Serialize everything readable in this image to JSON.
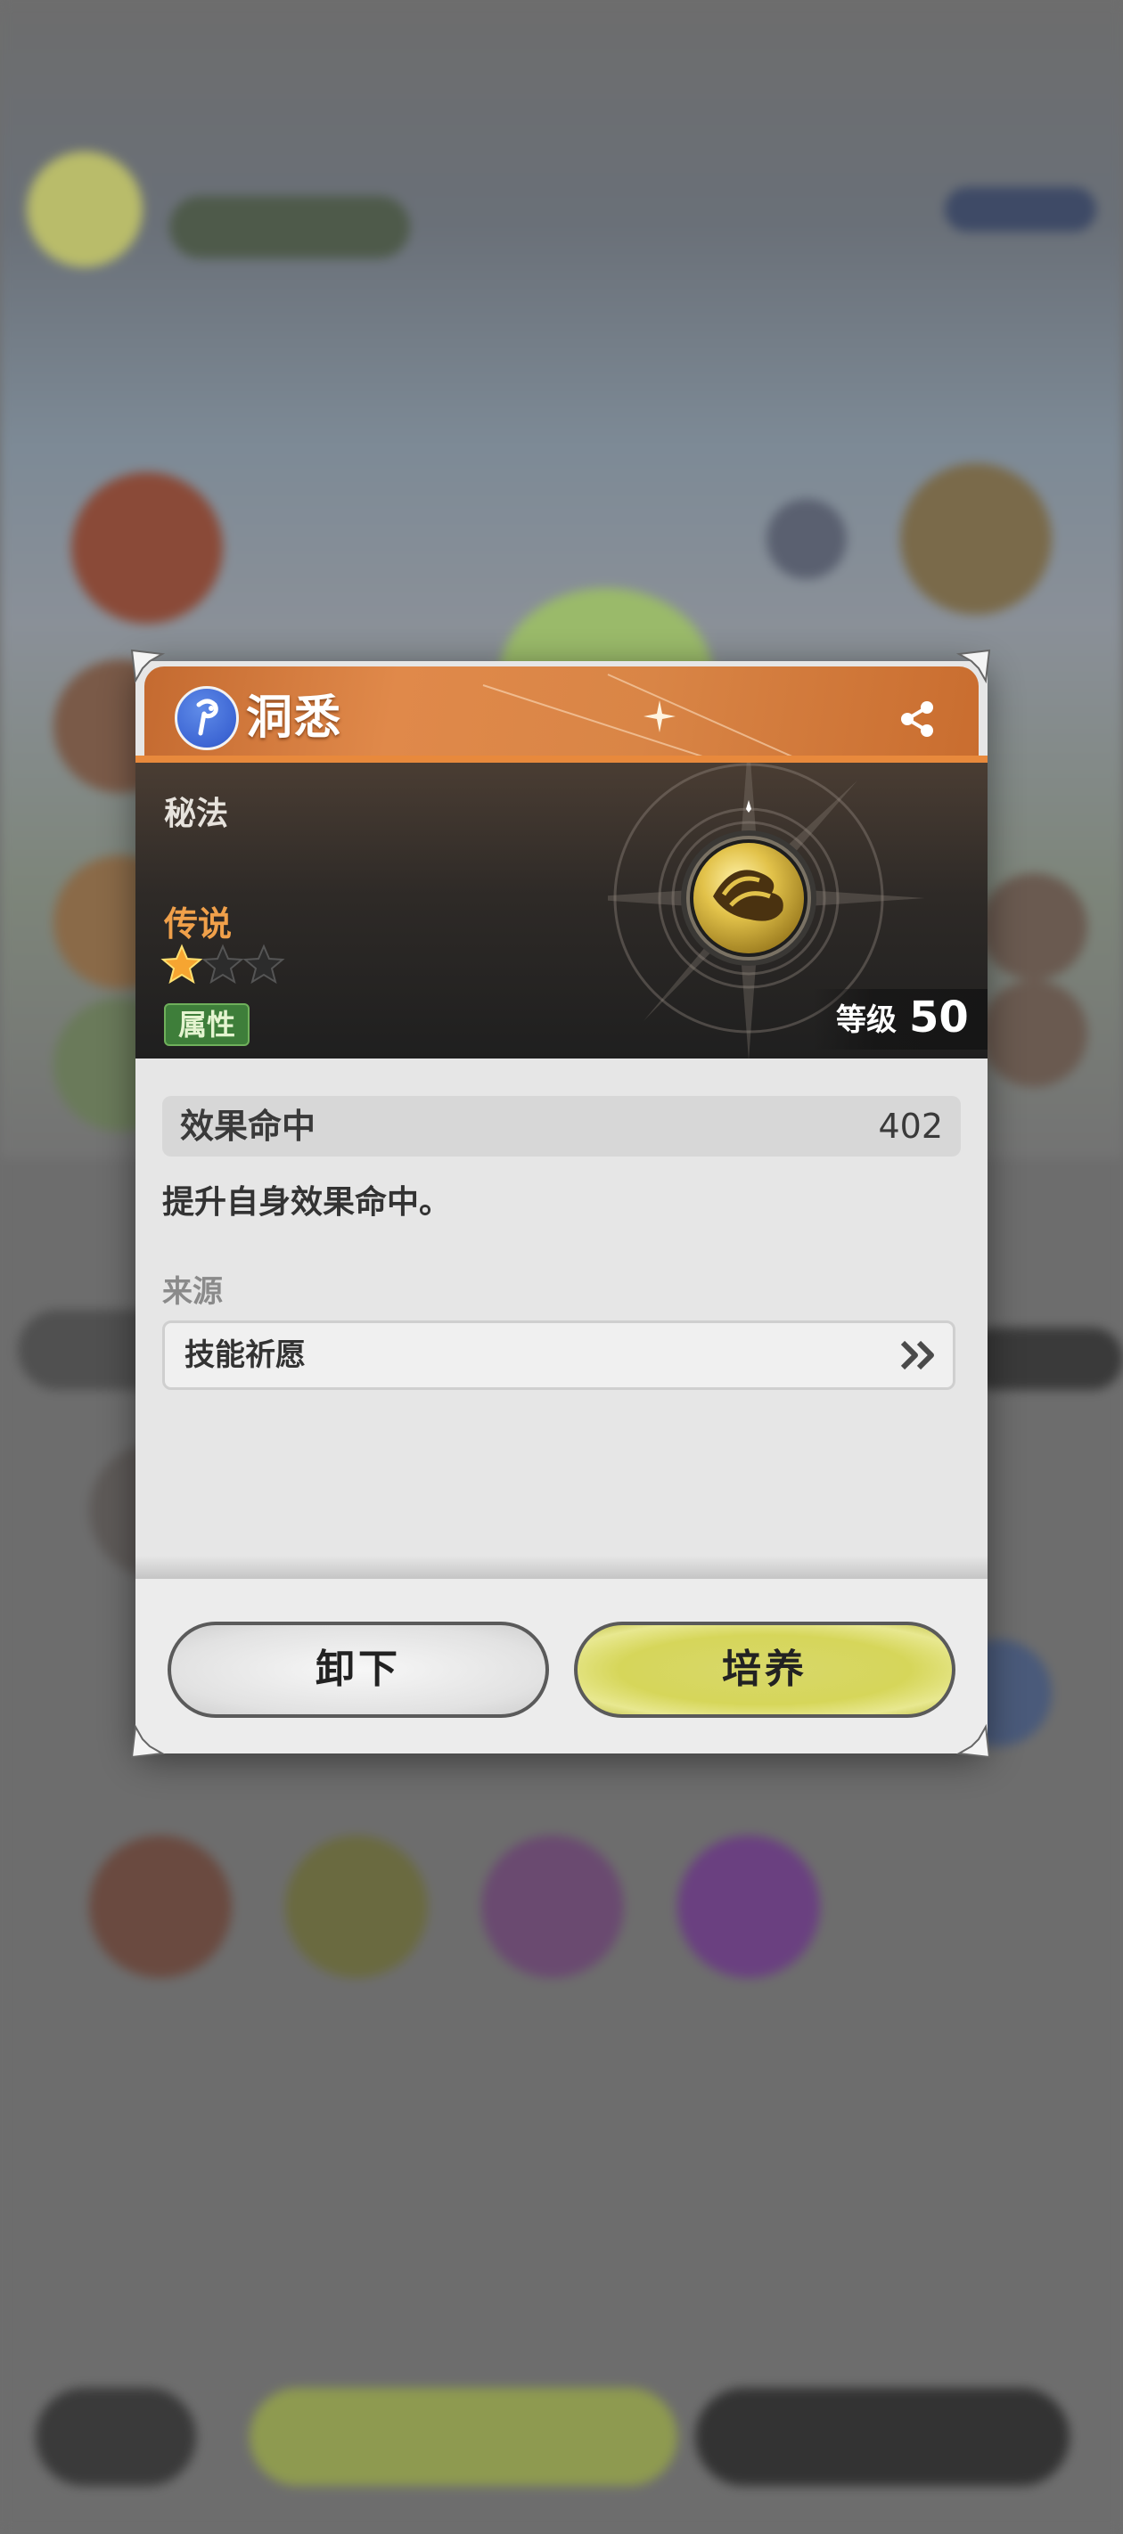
{
  "item": {
    "name": "洞悉",
    "category": "秘法",
    "rarity": "传说",
    "stars_filled": 1,
    "stars_total": 3,
    "attribute_tag": "属性",
    "level_label": "等级",
    "level_value": "50",
    "type_icon": "blue-sigil-icon",
    "emblem_icon": "golden-wing-orb-icon"
  },
  "stat": {
    "name": "效果命中",
    "value": "402"
  },
  "description": "提升自身效果命中。",
  "source": {
    "label": "来源",
    "entry": "技能祈愿",
    "arrow_icon": "double-chevron-right-icon"
  },
  "buttons": {
    "unequip": "卸下",
    "train": "培养"
  },
  "colors": {
    "header_orange": "#d98546",
    "rarity_orange": "#f0a04a",
    "train_yellow": "#d6d65a",
    "attribute_green": "#3e7e3a"
  }
}
